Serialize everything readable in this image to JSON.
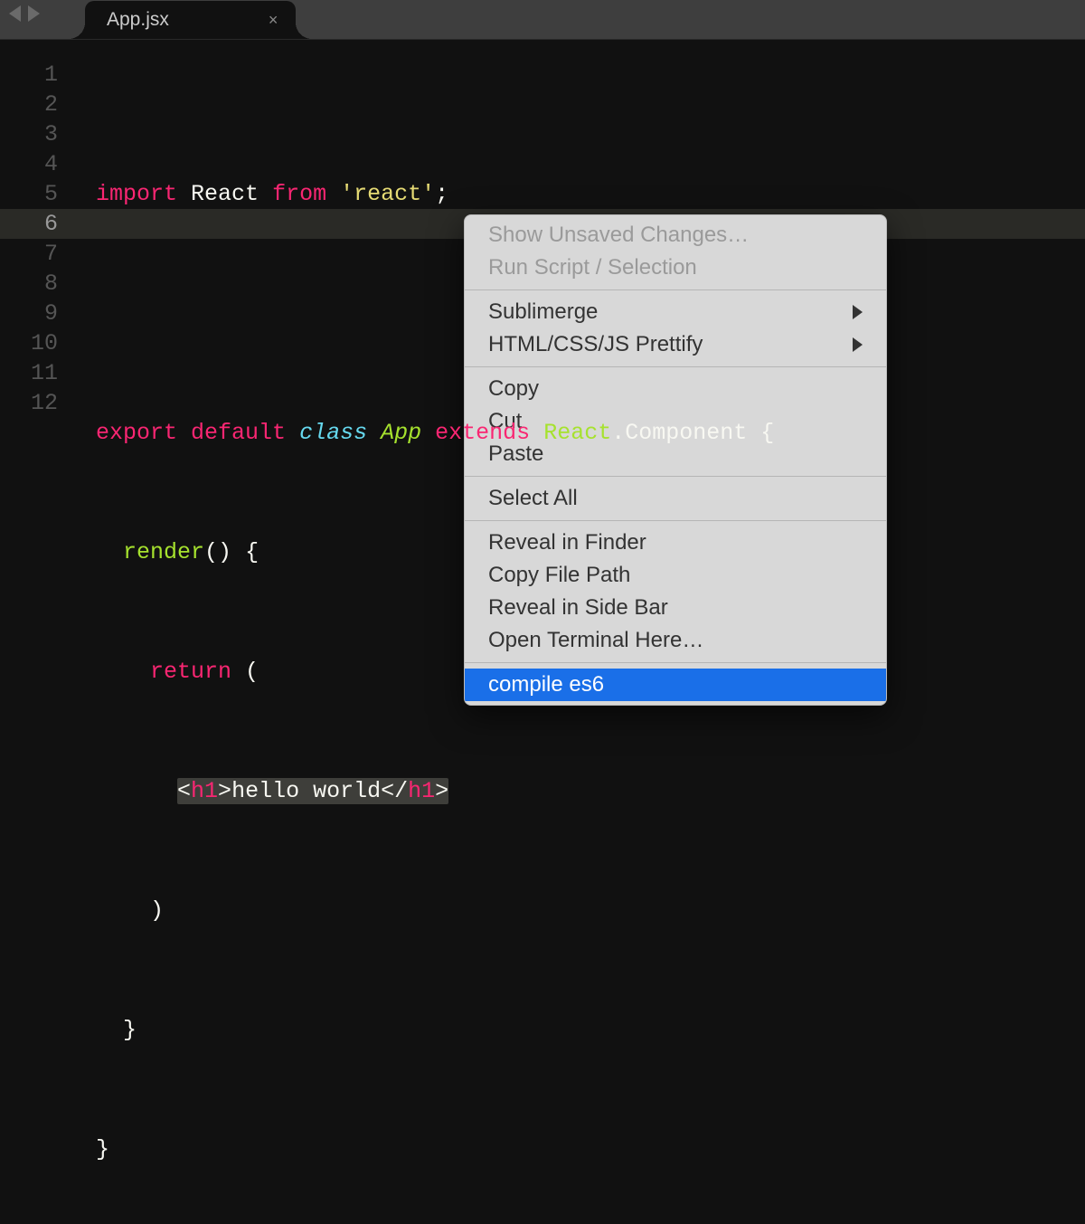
{
  "tab": {
    "title": "App.jsx",
    "close_glyph": "×"
  },
  "gutter": {
    "lines": [
      "1",
      "2",
      "3",
      "4",
      "5",
      "6",
      "7",
      "8",
      "9",
      "10",
      "11",
      "12"
    ],
    "active_index": 5
  },
  "code": {
    "l1": {
      "import": "import",
      "react": "React",
      "from": "from",
      "str": "'react'",
      "semi": ";"
    },
    "l3": {
      "export": "export",
      "default": "default",
      "class": "class",
      "app": "App",
      "extends": "extends",
      "reactc": "React",
      "dot": ".",
      "component": "Component",
      "brace": "{"
    },
    "l4": {
      "render": "render",
      "paren": "()",
      "brace": "{"
    },
    "l5": {
      "ret": "return",
      "paren": "("
    },
    "l6": {
      "open_lt": "<",
      "h1o": "h1",
      "open_gt": ">",
      "text": "hello world",
      "close_lt": "</",
      "h1c": "h1",
      "close_gt": ">"
    },
    "l7": {
      "paren": ")"
    },
    "l8": {
      "brace": "}"
    },
    "l9": {
      "brace": "}"
    }
  },
  "menu": {
    "show_unsaved": "Show Unsaved Changes…",
    "run_script": "Run Script / Selection",
    "sublimerge": "Sublimerge",
    "prettify": "HTML/CSS/JS Prettify",
    "copy": "Copy",
    "cut": "Cut",
    "paste": "Paste",
    "select_all": "Select All",
    "reveal_finder": "Reveal in Finder",
    "copy_path": "Copy File Path",
    "reveal_sidebar": "Reveal in Side Bar",
    "open_terminal": "Open Terminal Here…",
    "compile_es6": "compile es6"
  }
}
